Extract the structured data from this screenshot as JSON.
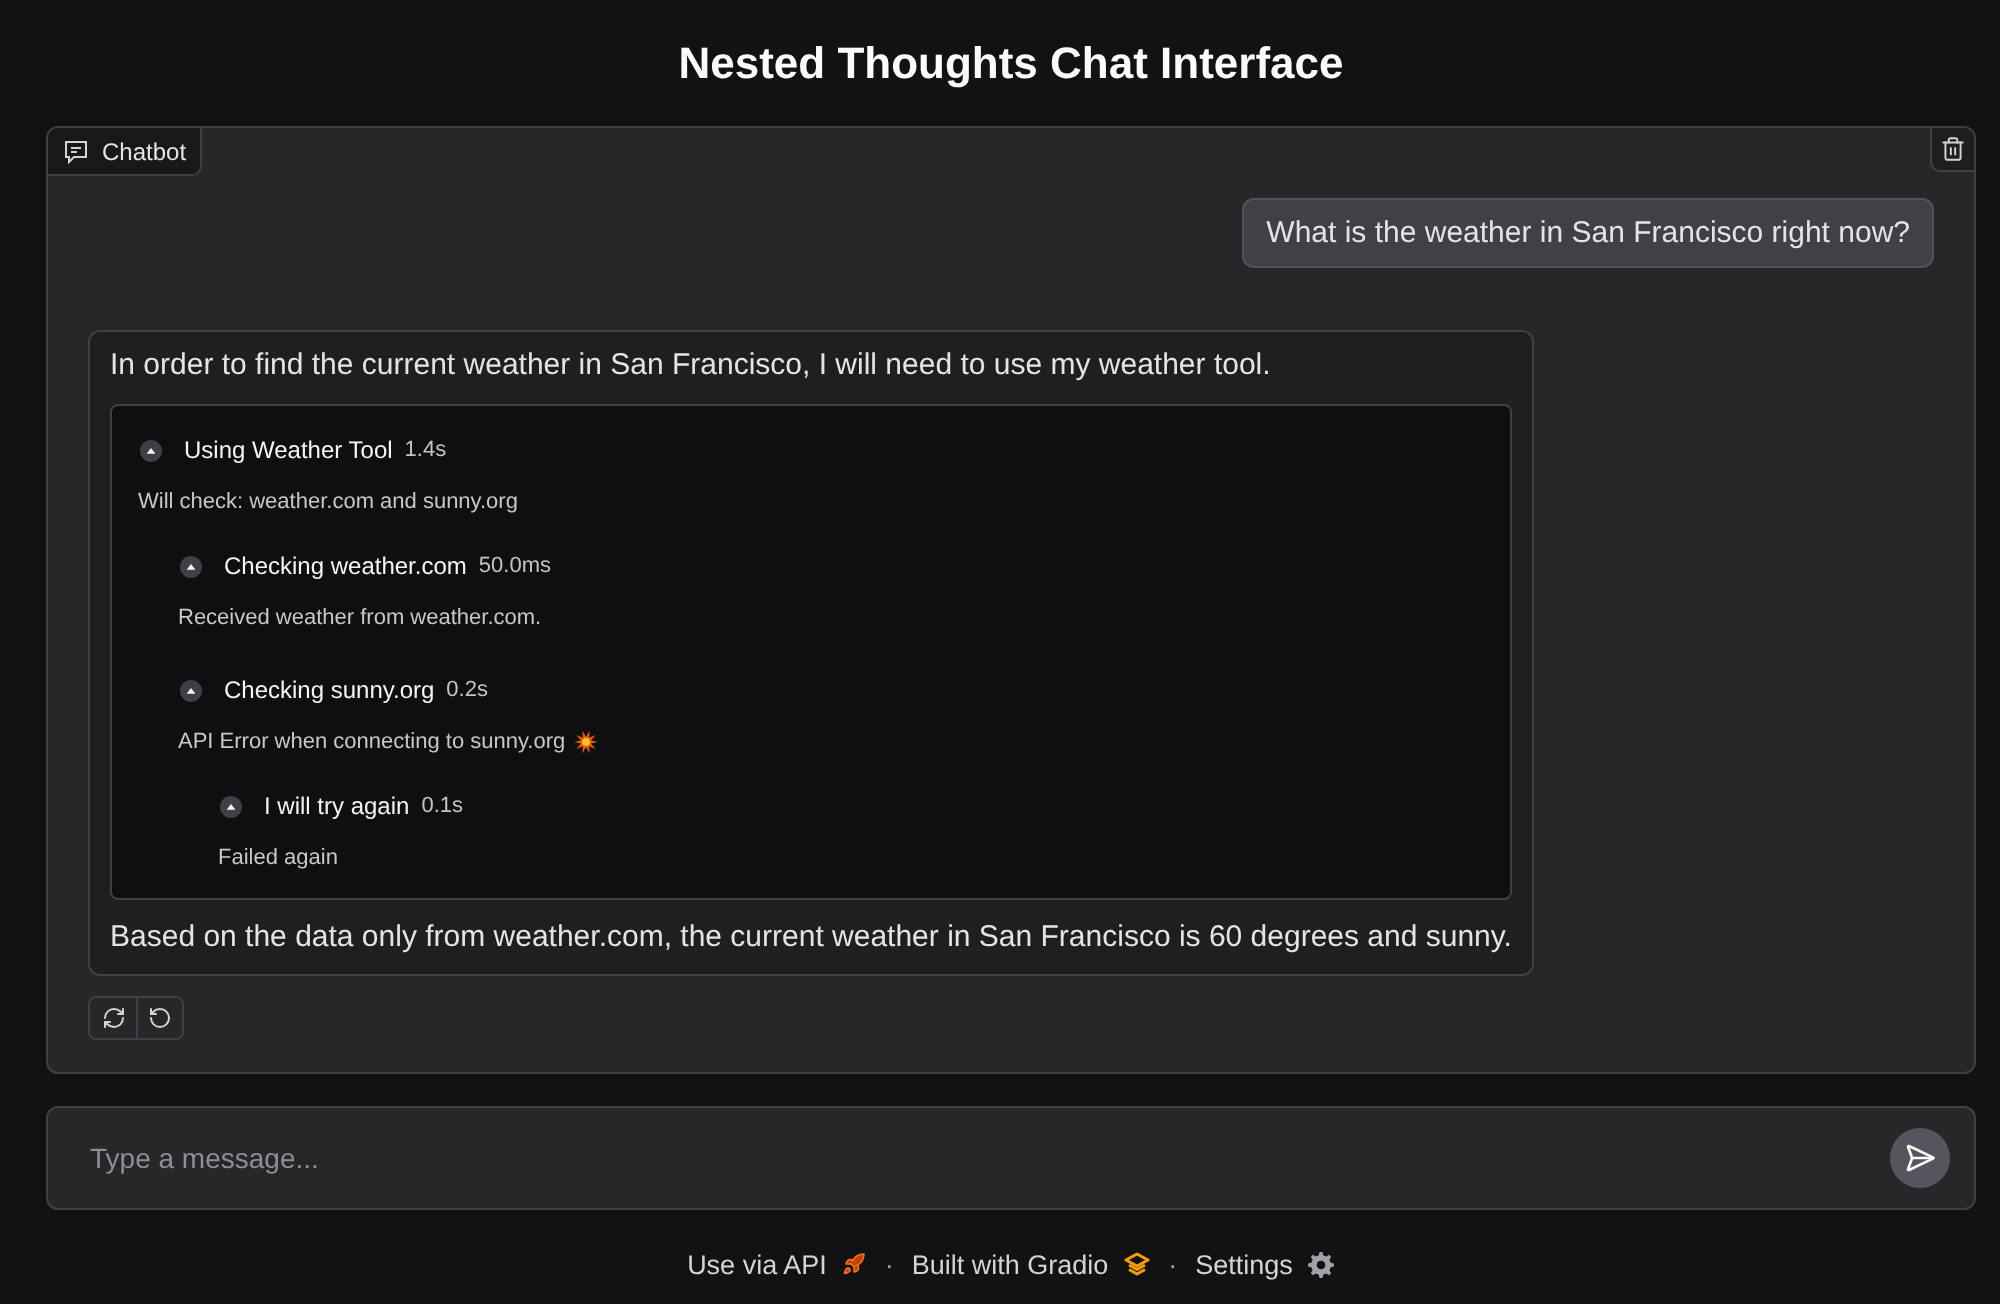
{
  "title": "Nested Thoughts Chat Interface",
  "chatbot": {
    "label": "Chatbot",
    "messages": [
      {
        "kind": "user",
        "text": "What is the weather in San Francisco right now?"
      },
      {
        "kind": "assistant",
        "content": [
          {
            "kind": "text",
            "text": "In order to find the current weather in San Francisco, I will need to use my weather tool."
          },
          {
            "kind": "thoughts",
            "items": [
              {
                "title": "Using Weather Tool",
                "duration": "1.4s",
                "expanded": true,
                "error": false,
                "content": "Will check: weather.com and sunny.org",
                "children": [
                  {
                    "title": "Checking weather.com",
                    "duration": "50.0ms",
                    "expanded": true,
                    "error": false,
                    "content": "Received weather from weather.com."
                  },
                  {
                    "title": "Checking sunny.org",
                    "duration": "0.2s",
                    "expanded": true,
                    "error": true,
                    "content": "API Error when connecting to sunny.org",
                    "children": [
                      {
                        "title": "I will try again",
                        "duration": "0.1s",
                        "expanded": true,
                        "error": false,
                        "content": "Failed again"
                      }
                    ]
                  }
                ]
              }
            ]
          },
          {
            "kind": "text",
            "text": "Based on the data only from weather.com, the current weather in San Francisco is 60 degrees and sunny."
          }
        ]
      }
    ]
  },
  "input": {
    "placeholder": "Type a message..."
  },
  "footer": [
    {
      "kind": "api",
      "label": "Use via API"
    },
    {
      "kind": "separator",
      "label": "·"
    },
    {
      "kind": "gradio",
      "label": "Built with Gradio"
    },
    {
      "kind": "separator",
      "label": "·"
    },
    {
      "kind": "settings",
      "label": "Settings"
    }
  ]
}
